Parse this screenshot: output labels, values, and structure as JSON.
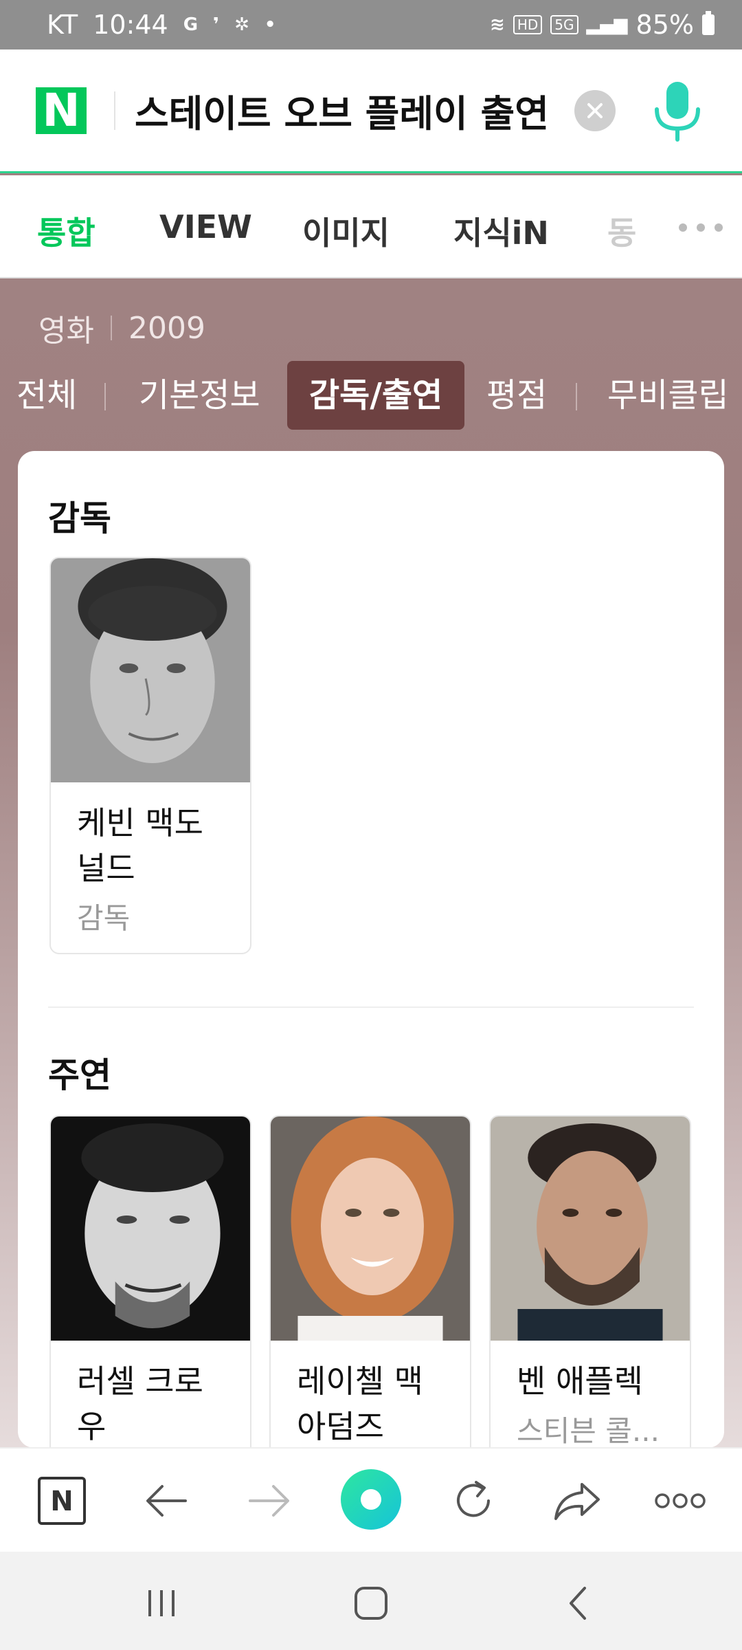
{
  "status_bar": {
    "carrier": "KT",
    "time": "10:44",
    "icons": [
      "google-icon",
      "message-icon",
      "settings-dot-icon",
      "dot"
    ],
    "net_badge_hd": "HD",
    "net_badge_5g": "5G",
    "battery": "85%"
  },
  "search": {
    "logo": "N",
    "query": "스테이트 오브 플레이 출연",
    "brand_color": "#03c75a"
  },
  "tabs": [
    {
      "label": "통합",
      "active": true
    },
    {
      "label": "VIEW"
    },
    {
      "label": "이미지"
    },
    {
      "label": "지식iN"
    },
    {
      "label": "동"
    }
  ],
  "movie": {
    "genre": "영화",
    "year": "2009"
  },
  "subtabs": [
    {
      "label": "전체"
    },
    {
      "label": "기본정보"
    },
    {
      "label": "감독/출연",
      "active": true
    },
    {
      "label": "평점"
    },
    {
      "label": "무비클립"
    }
  ],
  "director_section": {
    "title": "감독",
    "people": [
      {
        "name": "케빈 맥도\n널드",
        "role": "감독"
      }
    ]
  },
  "cast_section": {
    "title": "주연",
    "people": [
      {
        "name": "러셀 크로\n우",
        "role": ""
      },
      {
        "name": "레이첼 맥\n아덤즈",
        "role": ""
      },
      {
        "name": "벤 애플렉",
        "role": "스티븐 콜..."
      }
    ]
  },
  "toolbar": {
    "items": [
      "naver-home-icon",
      "back-icon",
      "forward-icon",
      "green-dot-icon",
      "refresh-icon",
      "share-icon",
      "more-icon"
    ]
  },
  "nav": {
    "items": [
      "recents-icon",
      "home-icon",
      "back-icon"
    ]
  }
}
